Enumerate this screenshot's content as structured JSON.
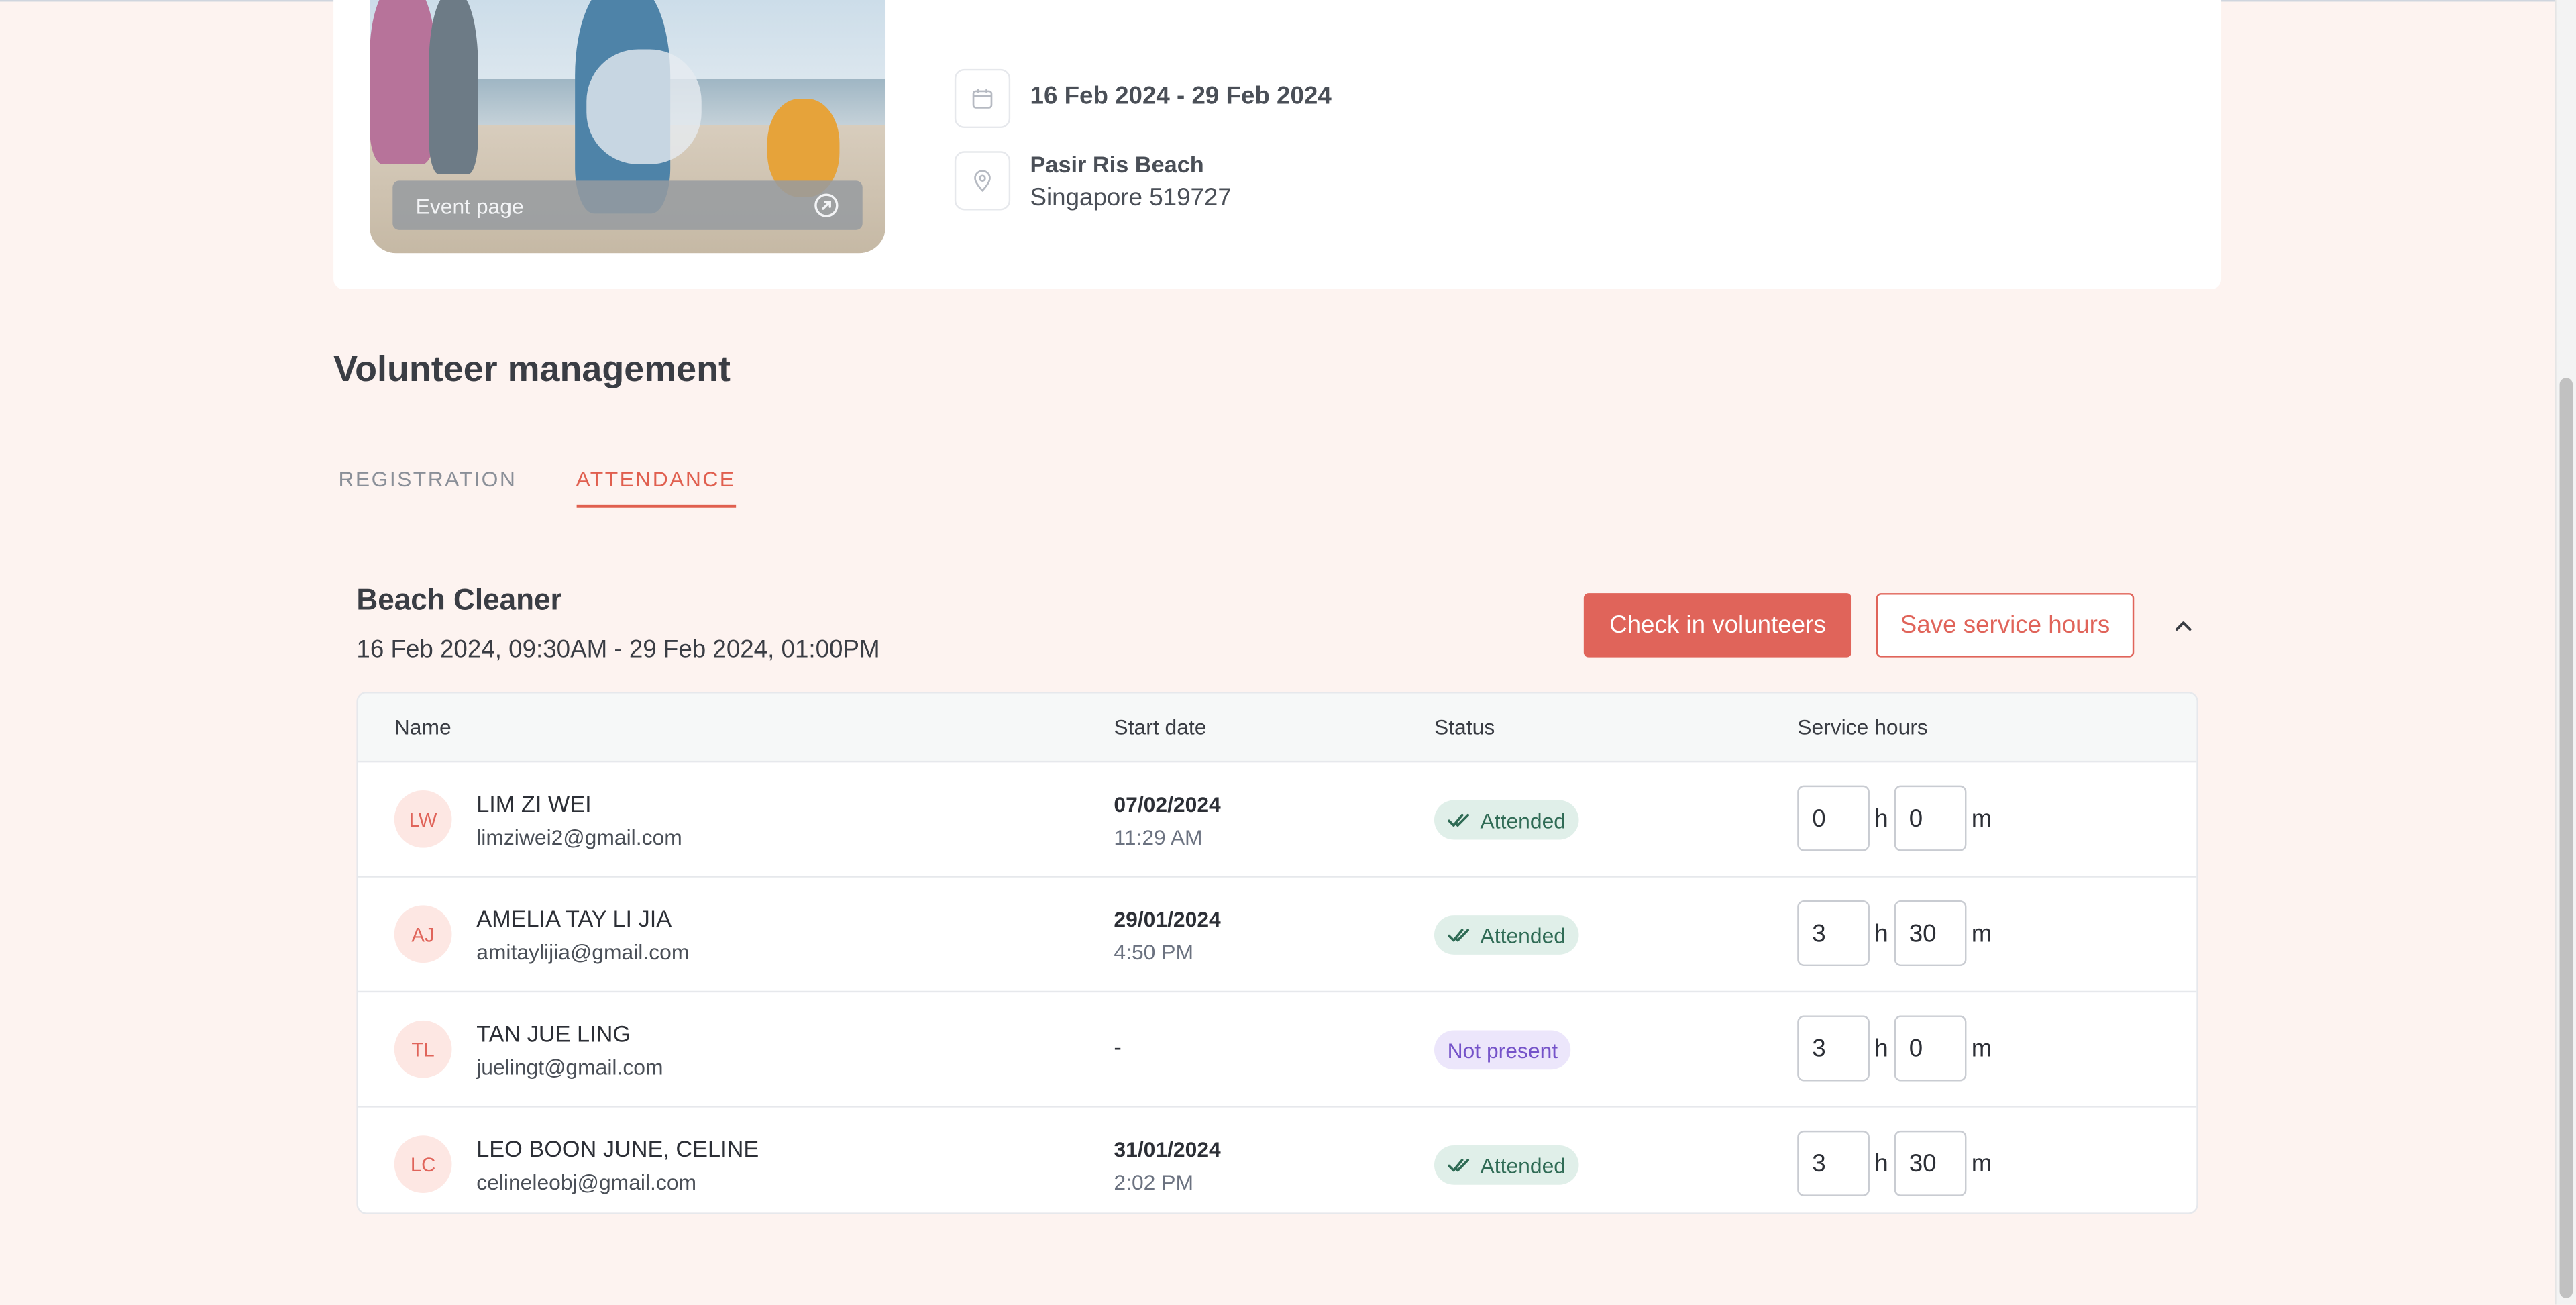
{
  "event": {
    "event_page_label": "Event page",
    "date_range": "16 Feb 2024 - 29 Feb 2024",
    "location_name": "Pasir Ris Beach",
    "location_address": "Singapore 519727"
  },
  "section": {
    "title": "Volunteer management",
    "tabs": [
      {
        "label": "REGISTRATION",
        "active": false
      },
      {
        "label": "ATTENDANCE",
        "active": true
      }
    ]
  },
  "shift": {
    "title": "Beach Cleaner",
    "time": "16 Feb 2024, 09:30AM - 29 Feb 2024, 01:00PM",
    "check_in_label": "Check in volunteers",
    "save_label": "Save service hours"
  },
  "table": {
    "headers": {
      "name": "Name",
      "start_date": "Start date",
      "status": "Status",
      "service_hours": "Service hours"
    },
    "unit_h": "h",
    "unit_m": "m",
    "rows": [
      {
        "initials": "LW",
        "name": "LIM ZI WEI",
        "email": "limziwei2@gmail.com",
        "date": "07/02/2024",
        "time": "11:29 AM",
        "status": "Attended",
        "hours": "0",
        "minutes": "0"
      },
      {
        "initials": "AJ",
        "name": "AMELIA TAY LI JIA",
        "email": "amitaylijia@gmail.com",
        "date": "29/01/2024",
        "time": "4:50 PM",
        "status": "Attended",
        "hours": "3",
        "minutes": "30"
      },
      {
        "initials": "TL",
        "name": "TAN JUE LING",
        "email": "juelingt@gmail.com",
        "date": "-",
        "time": "",
        "status": "Not present",
        "hours": "3",
        "minutes": "0"
      },
      {
        "initials": "LC",
        "name": "LEO BOON JUNE, CELINE",
        "email": "celineleobj@gmail.com",
        "date": "31/01/2024",
        "time": "2:02 PM",
        "status": "Attended",
        "hours": "3",
        "minutes": "30"
      }
    ]
  },
  "colors": {
    "accent": "#e0645a",
    "background": "#fdf3f0",
    "attended_bg": "#e0efe9",
    "not_present_bg": "#ece6fb"
  }
}
